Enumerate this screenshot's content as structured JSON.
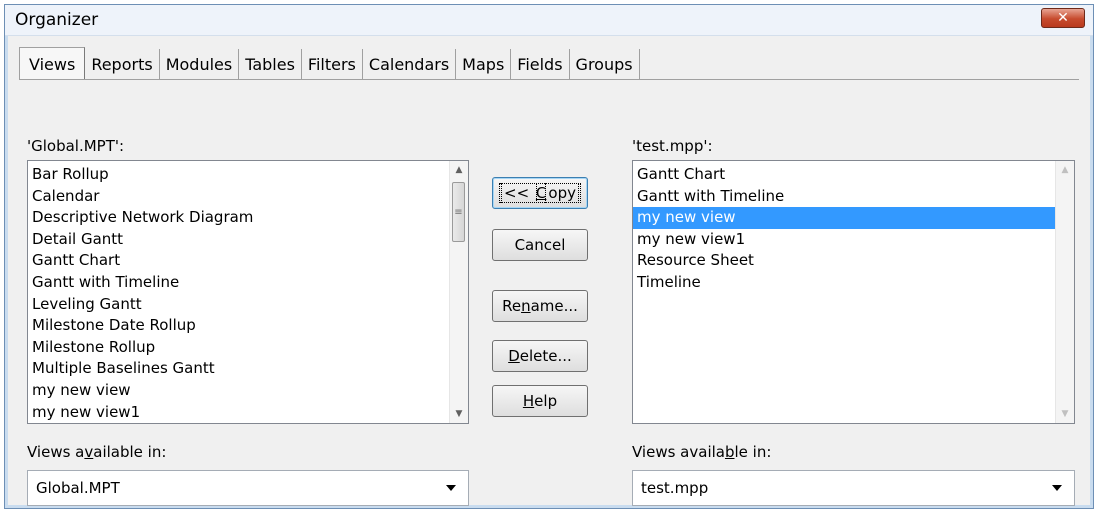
{
  "window": {
    "title": "Organizer",
    "close_glyph": "✕"
  },
  "tabs": [
    {
      "label": "Views",
      "active": true
    },
    {
      "label": "Reports"
    },
    {
      "label": "Modules"
    },
    {
      "label": "Tables"
    },
    {
      "label": "Filters"
    },
    {
      "label": "Calendars"
    },
    {
      "label": "Maps"
    },
    {
      "label": "Fields"
    },
    {
      "label": "Groups"
    }
  ],
  "left_panel": {
    "label": "'Global.MPT':",
    "items": [
      "Bar Rollup",
      "Calendar",
      "Descriptive Network Diagram",
      "Detail Gantt",
      "Gantt Chart",
      "Gantt with Timeline",
      "Leveling Gantt",
      "Milestone Date Rollup",
      "Milestone Rollup",
      "Multiple Baselines Gantt",
      "my new view",
      "my new view1"
    ],
    "available_label_pre": "Views a",
    "available_label_u": "v",
    "available_label_post": "ailable in:",
    "available_value": "Global.MPT"
  },
  "right_panel": {
    "label": "'test.mpp':",
    "items": [
      "Gantt Chart",
      "Gantt with Timeline",
      "my new view",
      "my new view1",
      "Resource Sheet",
      "Timeline"
    ],
    "selected_index": 2,
    "available_label_pre": "Views availa",
    "available_label_u": "b",
    "available_label_post": "le in:",
    "available_value": "test.mpp"
  },
  "buttons": {
    "copy": {
      "pre": "<< ",
      "u": "C",
      "post": "opy"
    },
    "cancel": {
      "label": "Cancel"
    },
    "rename": {
      "pre": "Re",
      "u": "n",
      "post": "ame..."
    },
    "delete": {
      "pre": "",
      "u": "D",
      "post": "elete..."
    },
    "help": {
      "pre": "",
      "u": "H",
      "post": "elp"
    }
  },
  "colors": {
    "selection": "#3399ff",
    "close": "#c74b2e"
  }
}
